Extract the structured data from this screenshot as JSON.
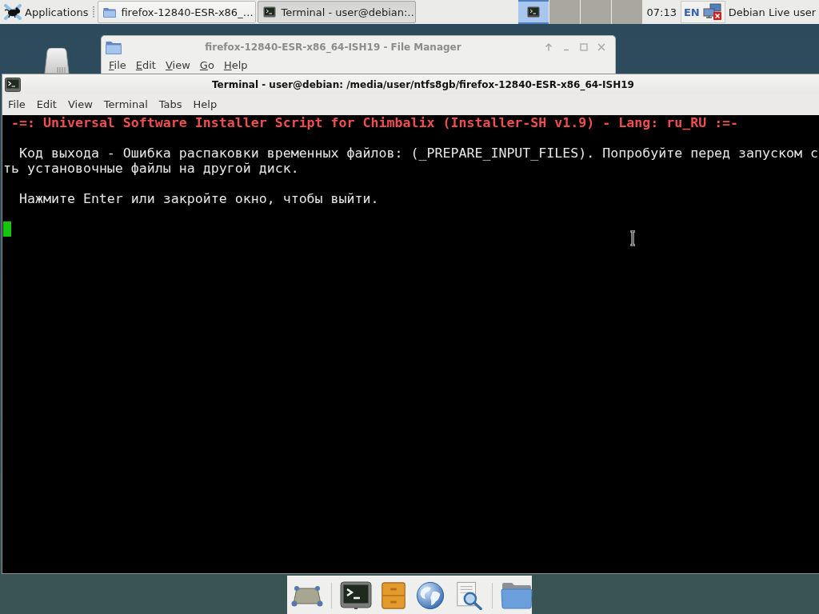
{
  "top_panel": {
    "applications_menu": "Applications",
    "tasks": [
      {
        "kind": "file-manager",
        "label": "firefox-12840-ESR-x86_…",
        "selected": false
      },
      {
        "kind": "terminal",
        "label": "Terminal - user@debian:…",
        "selected": true
      }
    ],
    "workspaces": [
      {
        "selected": true,
        "occupied": true
      },
      {
        "selected": false,
        "occupied": false
      },
      {
        "selected": false,
        "occupied": false
      },
      {
        "selected": false,
        "occupied": false
      }
    ],
    "clock": "07:13",
    "keyboard_layout": "EN",
    "network": {
      "connected": false
    },
    "user": "Debian Live user"
  },
  "file_manager": {
    "title": "firefox-12840-ESR-x86_64-ISH19 - File Manager",
    "active": false,
    "menu": [
      "File",
      "Edit",
      "View",
      "Go",
      "Help"
    ]
  },
  "terminal": {
    "title": "Terminal - user@debian: /media/user/ntfs8gb/firefox-12840-ESR-x86_64-ISH19",
    "active": true,
    "menu": [
      "File",
      "Edit",
      "View",
      "Terminal",
      "Tabs",
      "Help"
    ],
    "lines": [
      {
        "kind": "title",
        "text": "-=: Universal Software Installer Script for Chimbalix (Installer-SH v1.9) - Lang: ru_RU :=-"
      },
      {
        "kind": "blank"
      },
      {
        "kind": "message",
        "text": "Код выхода - Ошибка распаковки временных файлов: (_PREPARE_INPUT_FILES). Попробуйте перед запуском с"
      },
      {
        "kind": "continuation",
        "text": "ть установочные файлы на другой диск."
      },
      {
        "kind": "blank"
      },
      {
        "kind": "message",
        "text": "Нажмите Enter или закройте окно, чтобы выйти."
      },
      {
        "kind": "blank"
      },
      {
        "kind": "cursor"
      }
    ]
  }
}
